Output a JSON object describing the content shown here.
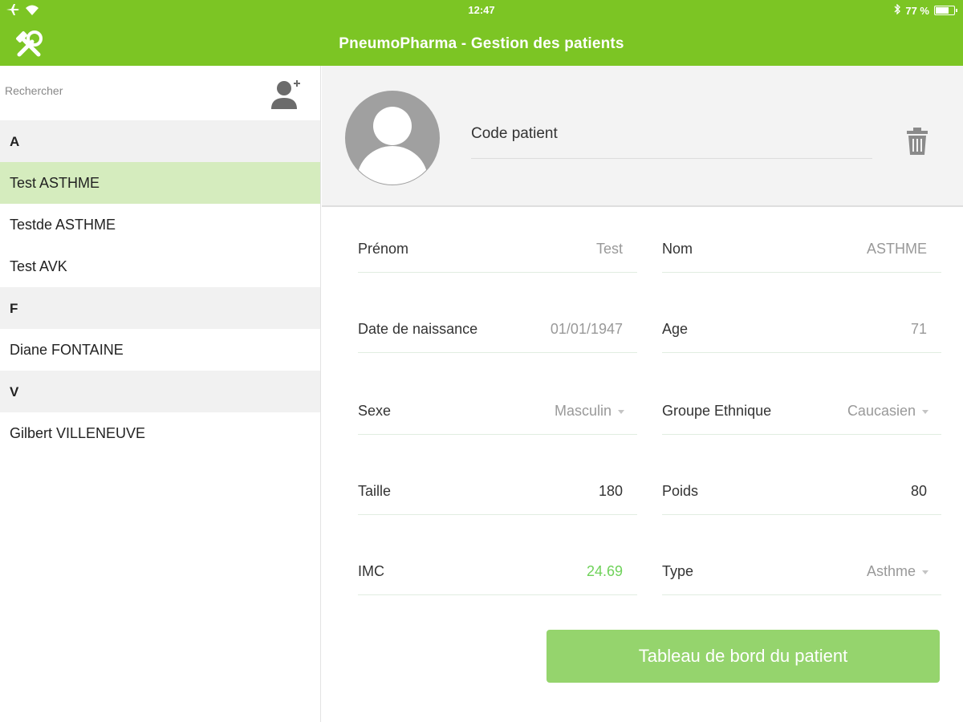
{
  "status": {
    "time": "12:47",
    "battery": "77 %",
    "battery_level": 0.77
  },
  "header": {
    "title": "PneumoPharma - Gestion des patients"
  },
  "search": {
    "placeholder": "Rechercher"
  },
  "patients": {
    "sections": [
      {
        "letter": "A",
        "items": [
          "Test ASTHME",
          "Testde ASTHME",
          "Test AVK"
        ]
      },
      {
        "letter": "F",
        "items": [
          "Diane FONTAINE"
        ]
      },
      {
        "letter": "V",
        "items": [
          "Gilbert VILLENEUVE"
        ]
      }
    ],
    "selected": "Test ASTHME"
  },
  "profile": {
    "code_label": "Code patient"
  },
  "form": {
    "prenom": {
      "label": "Prénom",
      "value": "Test"
    },
    "nom": {
      "label": "Nom",
      "value": "ASTHME"
    },
    "naissance": {
      "label": "Date de naissance",
      "value": "01/01/1947"
    },
    "age": {
      "label": "Age",
      "value": "71"
    },
    "sexe": {
      "label": "Sexe",
      "value": "Masculin"
    },
    "ethnie": {
      "label": "Groupe Ethnique",
      "value": "Caucasien"
    },
    "taille": {
      "label": "Taille",
      "value": "180"
    },
    "poids": {
      "label": "Poids",
      "value": "80"
    },
    "imc": {
      "label": "IMC",
      "value": "24.69"
    },
    "type": {
      "label": "Type",
      "value": "Asthme"
    }
  },
  "actions": {
    "dashboard_label": "Tableau de bord du patient"
  },
  "colors": {
    "brand": "#7cc524",
    "selected_row": "#d5ecbe",
    "button": "#95d46d",
    "imc_value": "#6fd25a"
  }
}
